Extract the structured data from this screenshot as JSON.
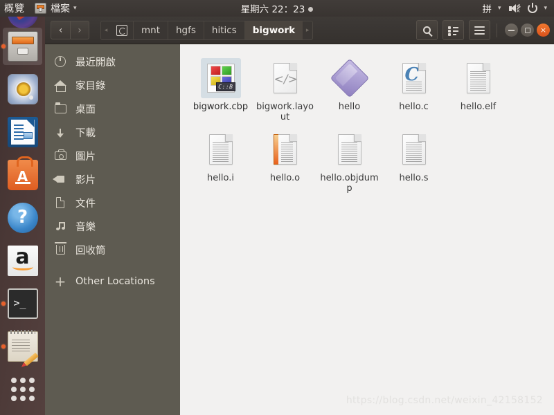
{
  "topbar": {
    "overview": "概覽",
    "app_icon": "files-cabinet-icon",
    "app_menu": "檔案",
    "caret": "▾",
    "clock": "星期六 22：23",
    "ime": "拼",
    "ime_caret": "▾",
    "volume_icon": "volume-muted-icon",
    "power_icon": "power-icon",
    "power_caret": "▾"
  },
  "launcher": {
    "items": [
      {
        "name": "firefox",
        "label": "Firefox",
        "running": false,
        "active": false
      },
      {
        "name": "files",
        "label": "檔案",
        "running": true,
        "active": true
      },
      {
        "name": "rhythmbox",
        "label": "Rhythmbox",
        "running": false,
        "active": false
      },
      {
        "name": "libreoffice",
        "label": "LibreOffice",
        "running": false,
        "active": false
      },
      {
        "name": "ubuntu-software",
        "label": "Ubuntu Software",
        "running": false,
        "active": false
      },
      {
        "name": "help",
        "label": "Help",
        "running": false,
        "active": false
      },
      {
        "name": "amazon",
        "label": "Amazon",
        "running": false,
        "active": false
      },
      {
        "name": "terminal",
        "label": "Terminal",
        "running": true,
        "active": false
      },
      {
        "name": "text-editor",
        "label": "Text Editor",
        "running": true,
        "active": false
      },
      {
        "name": "show-applications",
        "label": "Show Applications",
        "running": false,
        "active": false
      }
    ]
  },
  "window": {
    "nav": {
      "back": "‹",
      "forward": "›"
    },
    "breadcrumb": {
      "left_arrow": "◂",
      "right_arrow": "▸",
      "device_icon": "disk-icon",
      "items": [
        {
          "label": "mnt",
          "active": false
        },
        {
          "label": "hgfs",
          "active": false
        },
        {
          "label": "hitics",
          "active": false
        },
        {
          "label": "bigwork",
          "active": true
        }
      ]
    },
    "toolbar": {
      "search_icon": "search-icon",
      "view_list_icon": "list-view-icon",
      "menu_icon": "hamburger-menu-icon"
    },
    "controls": {
      "minimize": "−",
      "maximize": "□",
      "close": "×"
    }
  },
  "sidebar": {
    "items": [
      {
        "label": "最近開啟",
        "icon": "clock-icon"
      },
      {
        "label": "家目錄",
        "icon": "home-icon"
      },
      {
        "label": "桌面",
        "icon": "folder-icon"
      },
      {
        "label": "下載",
        "icon": "download-icon"
      },
      {
        "label": "圖片",
        "icon": "camera-icon"
      },
      {
        "label": "影片",
        "icon": "video-icon"
      },
      {
        "label": "文件",
        "icon": "document-icon"
      },
      {
        "label": "音樂",
        "icon": "music-icon"
      },
      {
        "label": "回收筒",
        "icon": "trash-icon"
      }
    ],
    "other_locations": {
      "label": "Other Locations",
      "icon": "plus-icon"
    }
  },
  "files": [
    {
      "name": "bigwork.cbp",
      "icon": "codeblocks-project-icon",
      "badge": "C::B",
      "selected": true
    },
    {
      "name": "bigwork.layout",
      "icon": "xml-document-icon",
      "selected": false
    },
    {
      "name": "hello",
      "icon": "executable-icon",
      "selected": false
    },
    {
      "name": "hello.c",
      "icon": "c-source-icon",
      "letter": "C",
      "selected": false
    },
    {
      "name": "hello.elf",
      "icon": "text-document-icon",
      "selected": false
    },
    {
      "name": "hello.i",
      "icon": "text-document-icon",
      "selected": false
    },
    {
      "name": "hello.o",
      "icon": "object-file-icon",
      "selected": false
    },
    {
      "name": "hello.objdump",
      "icon": "text-document-icon",
      "selected": false
    },
    {
      "name": "hello.s",
      "icon": "text-document-icon",
      "selected": false
    }
  ],
  "watermark": "https://blog.csdn.net/weixin_42158152",
  "colors": {
    "topbar": "#3c3734",
    "launcher": "#4a3836",
    "headerbar": "#3a3633",
    "sidebar": "#5e5b51",
    "content": "#f2f1f0",
    "accent_orange": "#e8602c",
    "close_button": "#e0621f"
  }
}
